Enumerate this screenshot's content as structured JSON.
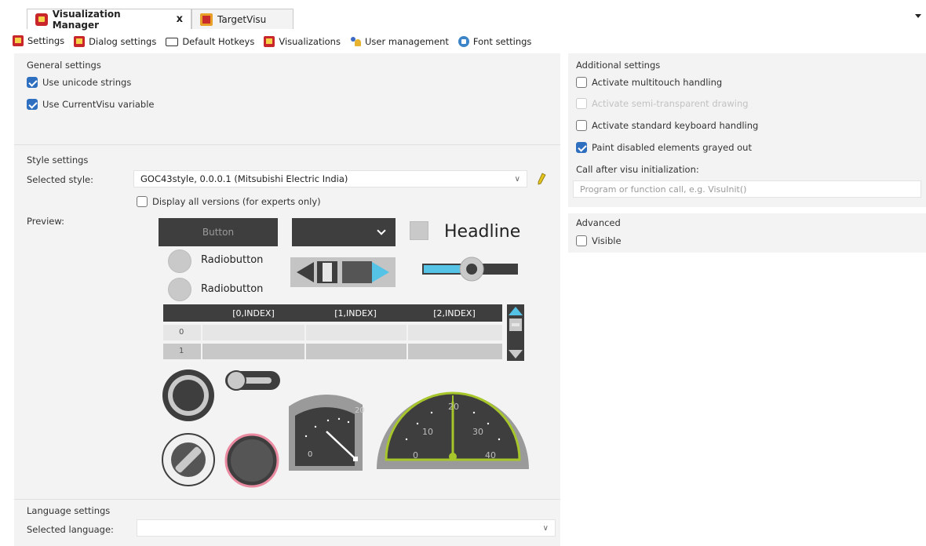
{
  "doc_tabs": [
    {
      "label": "Visualization Manager",
      "active": true,
      "close": "x"
    },
    {
      "label": "TargetVisu",
      "active": false
    }
  ],
  "subtabs": [
    {
      "label": "Settings",
      "icon": "settings-icon"
    },
    {
      "label": "Dialog settings",
      "icon": "dialog-settings-icon"
    },
    {
      "label": "Default Hotkeys",
      "icon": "keyboard-icon"
    },
    {
      "label": "Visualizations",
      "icon": "visualizations-icon"
    },
    {
      "label": "User management",
      "icon": "users-icon"
    },
    {
      "label": "Font settings",
      "icon": "font-icon"
    }
  ],
  "general": {
    "title": "General settings",
    "unicode": {
      "label": "Use unicode strings",
      "checked": true
    },
    "currentvisu": {
      "label": "Use CurrentVisu variable",
      "checked": true
    }
  },
  "style": {
    "title": "Style settings",
    "selected_label": "Selected style:",
    "selected_value": "GOC43style, 0.0.0.1 (Mitsubishi Electric India)",
    "display_all_label": "Display all versions (for experts only)",
    "display_all_checked": false,
    "preview_label": "Preview:"
  },
  "preview": {
    "button_label": "Button",
    "headline": "Headline",
    "radio1": "Radiobutton",
    "radio2": "Radiobutton",
    "table_headers": [
      "[0,INDEX]",
      "[1,INDEX]",
      "[2,INDEX]"
    ],
    "row_numbers": [
      "0",
      "1"
    ],
    "slider_level": 0.45,
    "gauge_quarter_labels": [
      "20",
      "0"
    ],
    "gauge_half_labels": [
      "10",
      "20",
      "30",
      "0",
      "40"
    ],
    "colors": {
      "dark": "#3e3e3e",
      "accent_blue": "#55c3e6",
      "gauge_green": "#a7c62b",
      "pink_ring": "#e98aa0"
    }
  },
  "language": {
    "title": "Language settings",
    "selected_label": "Selected language:",
    "selected_value": ""
  },
  "additional": {
    "title": "Additional settings",
    "multitouch": {
      "label": "Activate multitouch handling",
      "checked": false
    },
    "semitransparent": {
      "label": "Activate semi-transparent drawing",
      "checked": false,
      "disabled": true
    },
    "keyboard": {
      "label": "Activate standard keyboard handling",
      "checked": false
    },
    "grayed": {
      "label": "Paint disabled elements grayed out",
      "checked": true
    },
    "call_after_label": "Call after visu initialization:",
    "call_after_placeholder": "Program or function call, e.g. VisuInit()"
  },
  "advanced": {
    "title": "Advanced",
    "visible": {
      "label": "Visible",
      "checked": false
    }
  }
}
